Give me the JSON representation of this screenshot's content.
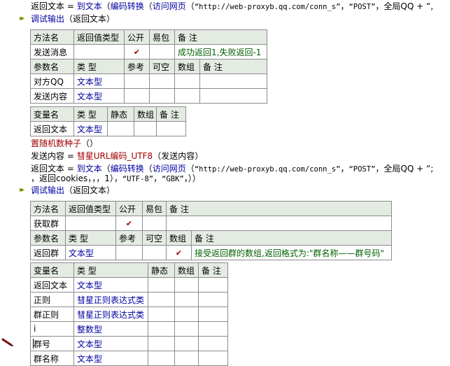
{
  "code": {
    "line1": {
      "lhs": "返回文本",
      "op": "=",
      "fn1": "到文本",
      "p1": "（",
      "fn2": "编码转换",
      "p2": "（",
      "fn3": "访问网页",
      "p3": "（",
      "url": "“http://web-proxyb.qq.com/conn_s”",
      "sep": "，",
      "method": "“POST”",
      "sep2": "，",
      "var": "全局QQ",
      "plus": "+",
      "rest": "“,"
    },
    "debug1": {
      "fn": "调试输出",
      "args": "（返回文本）"
    },
    "debug2": {
      "fn": "调试输出",
      "args": "（返回文本）"
    },
    "seed": {
      "fn": "置随机数种子",
      "args": "（）"
    },
    "send": {
      "lhs": "发送内容",
      "op": "=",
      "fn": "彗星URL编码_UTF8",
      "args": "（发送内容）"
    },
    "line2": {
      "lhs": "返回文本",
      "op": "=",
      "fn1": "到文本",
      "p1": "（",
      "fn2": "编码转换",
      "p2": "（",
      "fn3": "访问网页",
      "p3": "（",
      "url": "“http://web-proxyb.qq.com/conn_s”",
      "sep": "，",
      "method": "“POST”",
      "sep2": "，",
      "var": "全局QQ",
      "plus": "+",
      "rest": "“;"
    },
    "line2b": {
      "a": "，返回cookies，，，1），",
      "b": "“UTF-8”",
      "c": "，",
      "d": "“GBK”",
      "e": "，））"
    }
  },
  "method_send": {
    "headers": [
      "方法名",
      "返回值类型",
      "公开",
      "易包",
      "备 注"
    ],
    "row": {
      "name": "发送消息",
      "ret": "",
      "public": "✔",
      "easy": "",
      "note": "成功返回1,失败返回-1"
    },
    "param_headers": [
      "参数名",
      "类 型",
      "参考",
      "可空",
      "数组",
      "备 注"
    ],
    "params": [
      {
        "name": "对方QQ",
        "type": "文本型"
      },
      {
        "name": "发送内容",
        "type": "文本型"
      }
    ]
  },
  "vars_send": {
    "headers": [
      "变量名",
      "类 型",
      "静态",
      "数组",
      "备 注"
    ],
    "rows": [
      {
        "name": "返回文本",
        "type": "文本型"
      }
    ]
  },
  "method_group": {
    "headers": [
      "方法名",
      "返回值类型",
      "公开",
      "易包",
      "备 注"
    ],
    "row": {
      "name": "获取群",
      "ret": "",
      "public": "✔",
      "easy": "",
      "note": ""
    },
    "param_headers": [
      "参数名",
      "类 型",
      "参考",
      "可空",
      "数组",
      "备 注"
    ],
    "params": [
      {
        "name": "返回群",
        "type": "文本型",
        "array": "✔",
        "note": "接受返回群的数组,返回格式为:\"群名称——群号码\""
      }
    ]
  },
  "vars_group": {
    "headers": [
      "变量名",
      "类 型",
      "静态",
      "数组",
      "备 注"
    ],
    "rows": [
      {
        "name": "返回文本",
        "type": "文本型"
      },
      {
        "name": "正则",
        "type": "彗星正则表达式类"
      },
      {
        "name": "群正则",
        "type": "彗星正则表达式类"
      },
      {
        "name": "i",
        "type": "整数型"
      },
      {
        "name": "群号",
        "type": "文本型"
      },
      {
        "name": "群名称",
        "type": "文本型"
      }
    ]
  }
}
